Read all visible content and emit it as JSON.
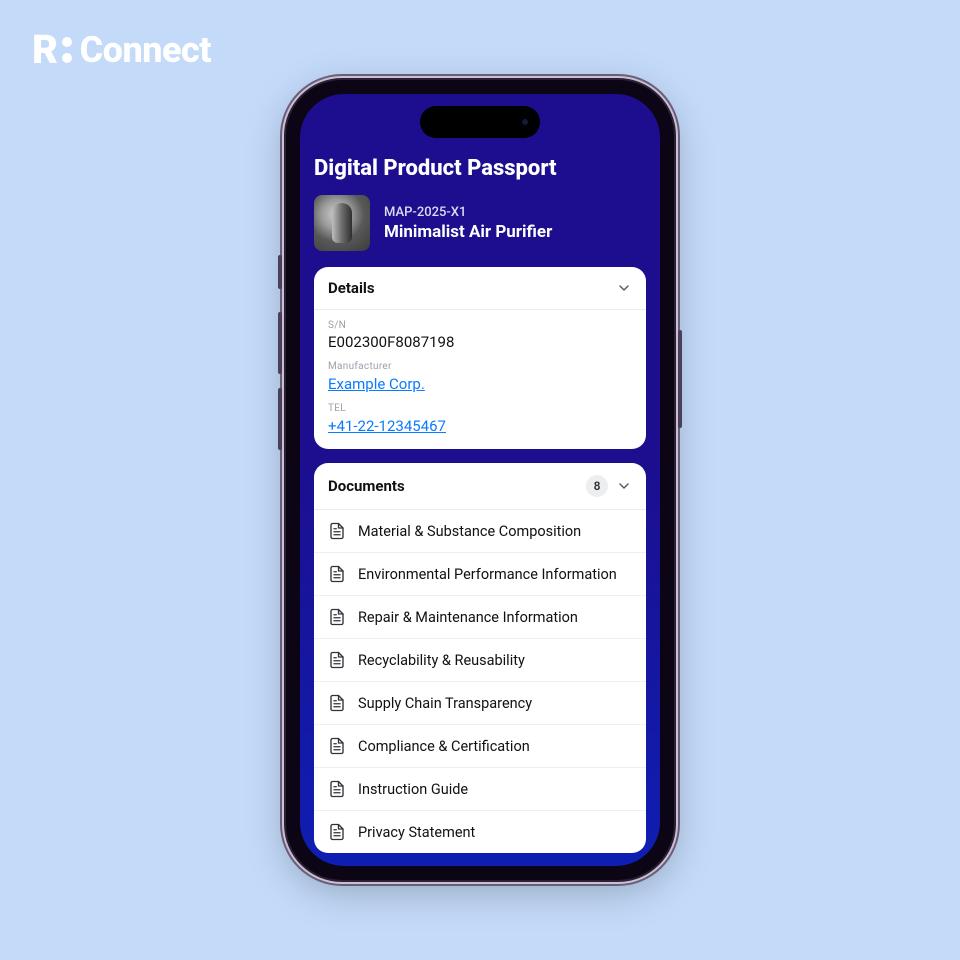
{
  "brand": {
    "name": "Connect"
  },
  "page": {
    "title": "Digital Product Passport"
  },
  "product": {
    "code": "MAP-2025-X1",
    "name": "Minimalist Air Purifier"
  },
  "details": {
    "title": "Details",
    "sn_label": "S/N",
    "sn_value": "E002300F8087198",
    "manufacturer_label": "Manufacturer",
    "manufacturer_value": "Example Corp.",
    "tel_label": "TEL",
    "tel_value": "+41-22-12345467"
  },
  "documents": {
    "title": "Documents",
    "count": "8",
    "items": [
      "Material & Substance Composition",
      "Environmental Performance Information",
      "Repair & Maintenance Information",
      "Recyclability & Reusability",
      "Supply Chain Transparency",
      "Compliance & Certification",
      "Instruction Guide",
      "Privacy Statement"
    ]
  }
}
